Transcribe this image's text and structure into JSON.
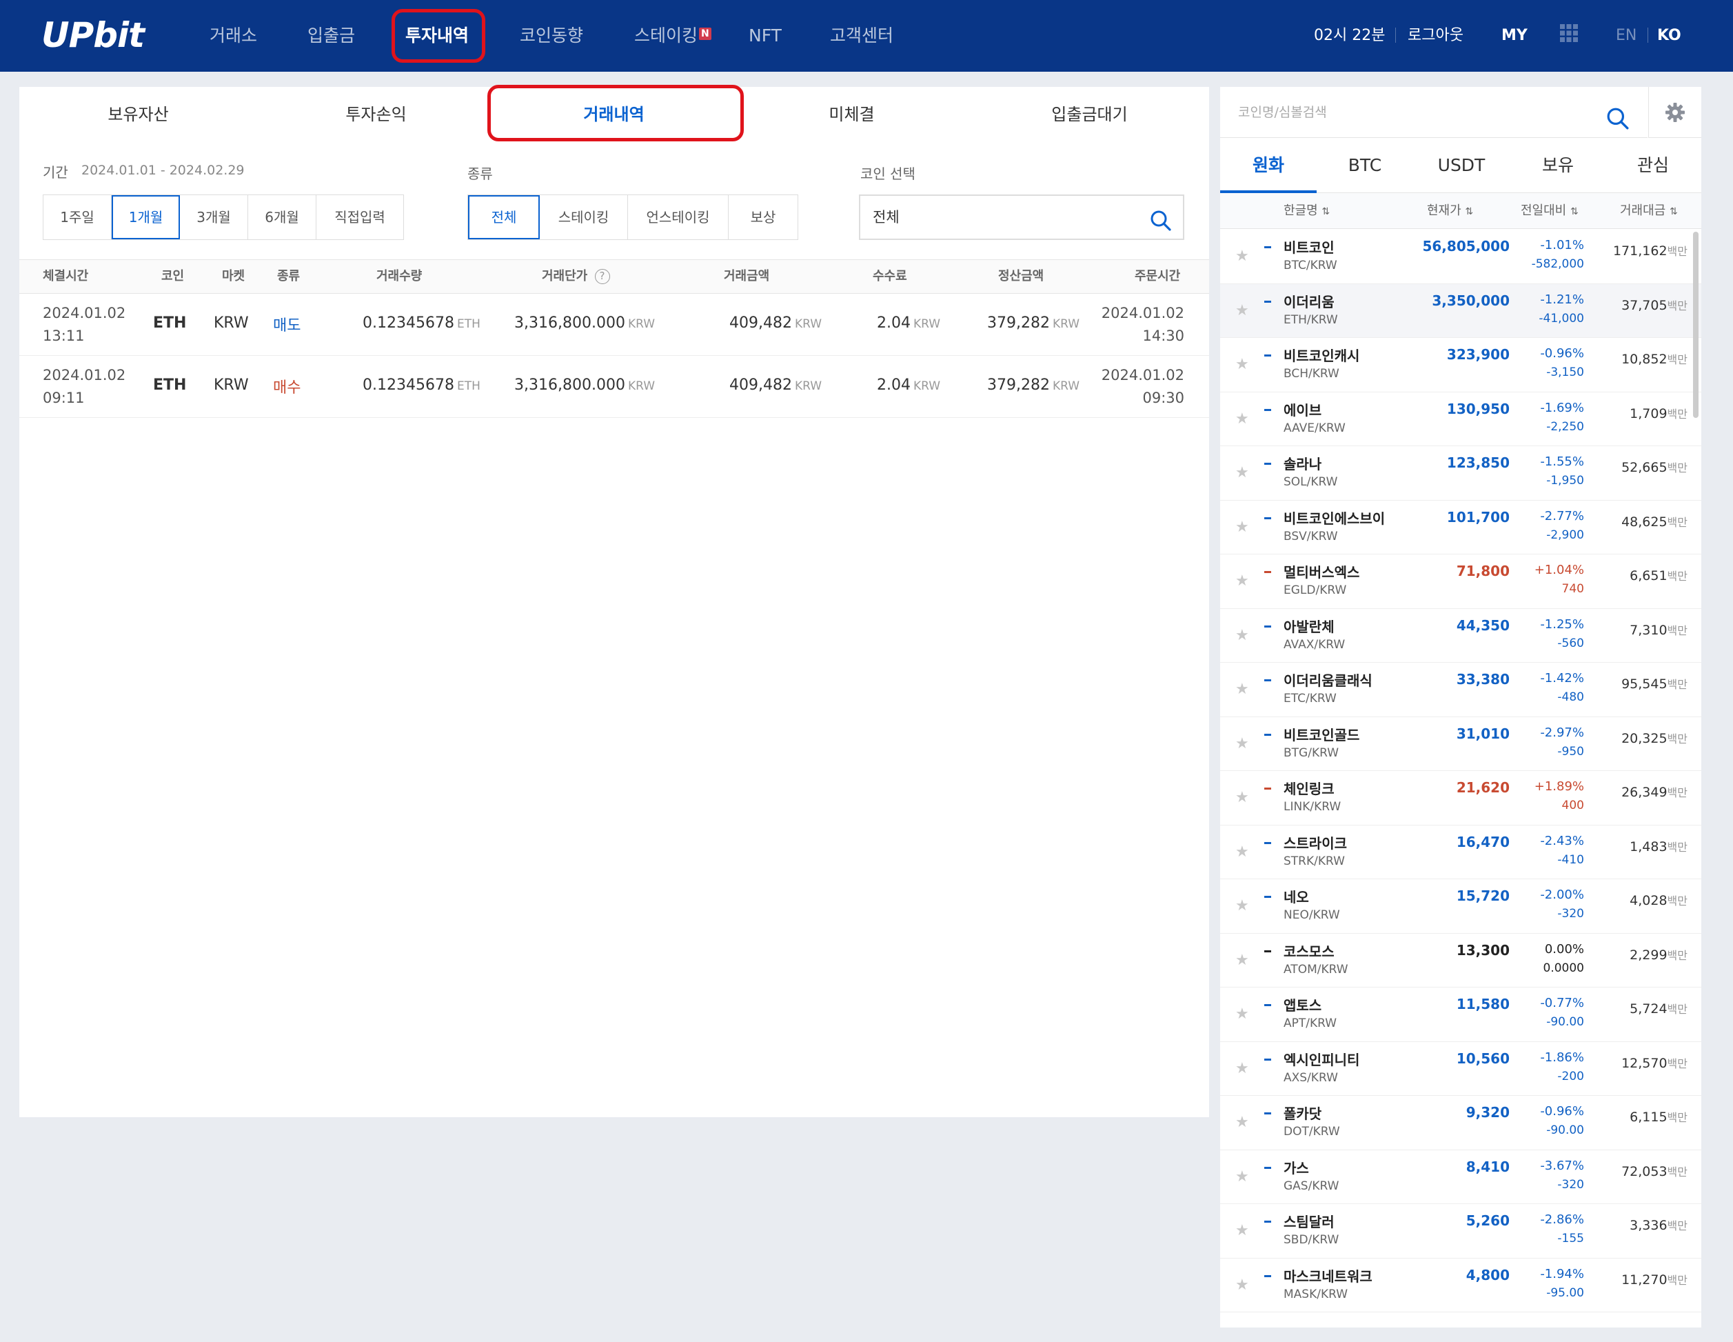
{
  "header": {
    "logo": "UPbit",
    "nav": [
      "거래소",
      "입출금",
      "투자내역",
      "코인동향",
      "스테이킹",
      "NFT",
      "고객센터"
    ],
    "active_nav": "투자내역",
    "new_badge": "N",
    "time": "02시 22분",
    "logout": "로그아웃",
    "my": "MY",
    "lang_en": "EN",
    "lang_ko": "KO"
  },
  "tabs": [
    "보유자산",
    "투자손익",
    "거래내역",
    "미체결",
    "입출금대기"
  ],
  "active_tab": "거래내역",
  "filters": {
    "period_label": "기간",
    "period_range": "2024.01.01 - 2024.02.29",
    "period_buttons": [
      "1주일",
      "1개월",
      "3개월",
      "6개월",
      "직접입력"
    ],
    "period_selected": "1개월",
    "type_label": "종류",
    "type_buttons": [
      "전체",
      "스테이킹",
      "언스테이킹",
      "보상"
    ],
    "type_selected": "전체",
    "coin_label": "코인 선택",
    "coin_value": "전체"
  },
  "table": {
    "headers": [
      "체결시간",
      "코인",
      "마켓",
      "종류",
      "거래수량",
      "거래단가",
      "거래금액",
      "수수료",
      "정산금액",
      "주문시간"
    ],
    "rows": [
      {
        "time_date": "2024.01.02",
        "time_clock": "13:11",
        "coin": "ETH",
        "market": "KRW",
        "type": "매도",
        "qty": "0.12345678",
        "qty_unit": "ETH",
        "price": "3,316,800.000",
        "price_unit": "KRW",
        "amount": "409,482",
        "amount_unit": "KRW",
        "fee": "2.04",
        "fee_unit": "KRW",
        "settle": "379,282",
        "settle_unit": "KRW",
        "order_date": "2024.01.02",
        "order_clock": "14:30"
      },
      {
        "time_date": "2024.01.02",
        "time_clock": "09:11",
        "coin": "ETH",
        "market": "KRW",
        "type": "매수",
        "qty": "0.12345678",
        "qty_unit": "ETH",
        "price": "3,316,800.000",
        "price_unit": "KRW",
        "amount": "409,482",
        "amount_unit": "KRW",
        "fee": "2.04",
        "fee_unit": "KRW",
        "settle": "379,282",
        "settle_unit": "KRW",
        "order_date": "2024.01.02",
        "order_clock": "09:30"
      }
    ]
  },
  "market": {
    "search_placeholder": "코인명/심볼검색",
    "tabs": [
      "원화",
      "BTC",
      "USDT",
      "보유",
      "관심"
    ],
    "active_tab": "원화",
    "headers": [
      "한글명",
      "현재가",
      "전일대비",
      "거래대금"
    ],
    "vol_unit": "백만",
    "rows": [
      {
        "name": "비트코인",
        "pair": "BTC/KRW",
        "price": "56,805,000",
        "pct": "-1.01%",
        "chg": "-582,000",
        "vol": "171,162",
        "dir": "dn"
      },
      {
        "name": "이더리움",
        "pair": "ETH/KRW",
        "price": "3,350,000",
        "pct": "-1.21%",
        "chg": "-41,000",
        "vol": "37,705",
        "dir": "dn"
      },
      {
        "name": "비트코인캐시",
        "pair": "BCH/KRW",
        "price": "323,900",
        "pct": "-0.96%",
        "chg": "-3,150",
        "vol": "10,852",
        "dir": "dn"
      },
      {
        "name": "에이브",
        "pair": "AAVE/KRW",
        "price": "130,950",
        "pct": "-1.69%",
        "chg": "-2,250",
        "vol": "1,709",
        "dir": "dn"
      },
      {
        "name": "솔라나",
        "pair": "SOL/KRW",
        "price": "123,850",
        "pct": "-1.55%",
        "chg": "-1,950",
        "vol": "52,665",
        "dir": "dn"
      },
      {
        "name": "비트코인에스브이",
        "pair": "BSV/KRW",
        "price": "101,700",
        "pct": "-2.77%",
        "chg": "-2,900",
        "vol": "48,625",
        "dir": "dn"
      },
      {
        "name": "멀티버스엑스",
        "pair": "EGLD/KRW",
        "price": "71,800",
        "pct": "+1.04%",
        "chg": "740",
        "vol": "6,651",
        "dir": "up"
      },
      {
        "name": "아발란체",
        "pair": "AVAX/KRW",
        "price": "44,350",
        "pct": "-1.25%",
        "chg": "-560",
        "vol": "7,310",
        "dir": "dn"
      },
      {
        "name": "이더리움클래식",
        "pair": "ETC/KRW",
        "price": "33,380",
        "pct": "-1.42%",
        "chg": "-480",
        "vol": "95,545",
        "dir": "dn"
      },
      {
        "name": "비트코인골드",
        "pair": "BTG/KRW",
        "price": "31,010",
        "pct": "-2.97%",
        "chg": "-950",
        "vol": "20,325",
        "dir": "dn"
      },
      {
        "name": "체인링크",
        "pair": "LINK/KRW",
        "price": "21,620",
        "pct": "+1.89%",
        "chg": "400",
        "vol": "26,349",
        "dir": "up"
      },
      {
        "name": "스트라이크",
        "pair": "STRK/KRW",
        "price": "16,470",
        "pct": "-2.43%",
        "chg": "-410",
        "vol": "1,483",
        "dir": "dn"
      },
      {
        "name": "네오",
        "pair": "NEO/KRW",
        "price": "15,720",
        "pct": "-2.00%",
        "chg": "-320",
        "vol": "4,028",
        "dir": "dn"
      },
      {
        "name": "코스모스",
        "pair": "ATOM/KRW",
        "price": "13,300",
        "pct": "0.00%",
        "chg": "0.0000",
        "vol": "2,299",
        "dir": "ev"
      },
      {
        "name": "앱토스",
        "pair": "APT/KRW",
        "price": "11,580",
        "pct": "-0.77%",
        "chg": "-90.00",
        "vol": "5,724",
        "dir": "dn"
      },
      {
        "name": "엑시인피니티",
        "pair": "AXS/KRW",
        "price": "10,560",
        "pct": "-1.86%",
        "chg": "-200",
        "vol": "12,570",
        "dir": "dn"
      },
      {
        "name": "폴카닷",
        "pair": "DOT/KRW",
        "price": "9,320",
        "pct": "-0.96%",
        "chg": "-90.00",
        "vol": "6,115",
        "dir": "dn"
      },
      {
        "name": "가스",
        "pair": "GAS/KRW",
        "price": "8,410",
        "pct": "-3.67%",
        "chg": "-320",
        "vol": "72,053",
        "dir": "dn"
      },
      {
        "name": "스팀달러",
        "pair": "SBD/KRW",
        "price": "5,260",
        "pct": "-2.86%",
        "chg": "-155",
        "vol": "3,336",
        "dir": "dn"
      },
      {
        "name": "마스크네트워크",
        "pair": "MASK/KRW",
        "price": "4,800",
        "pct": "-1.94%",
        "chg": "-95.00",
        "vol": "11,270",
        "dir": "dn"
      }
    ]
  },
  "colors": {
    "brand": "#093687",
    "accent": "#0a62d0",
    "up": "#c84a31",
    "down": "#1261c4",
    "highlight": "#e0131b"
  }
}
